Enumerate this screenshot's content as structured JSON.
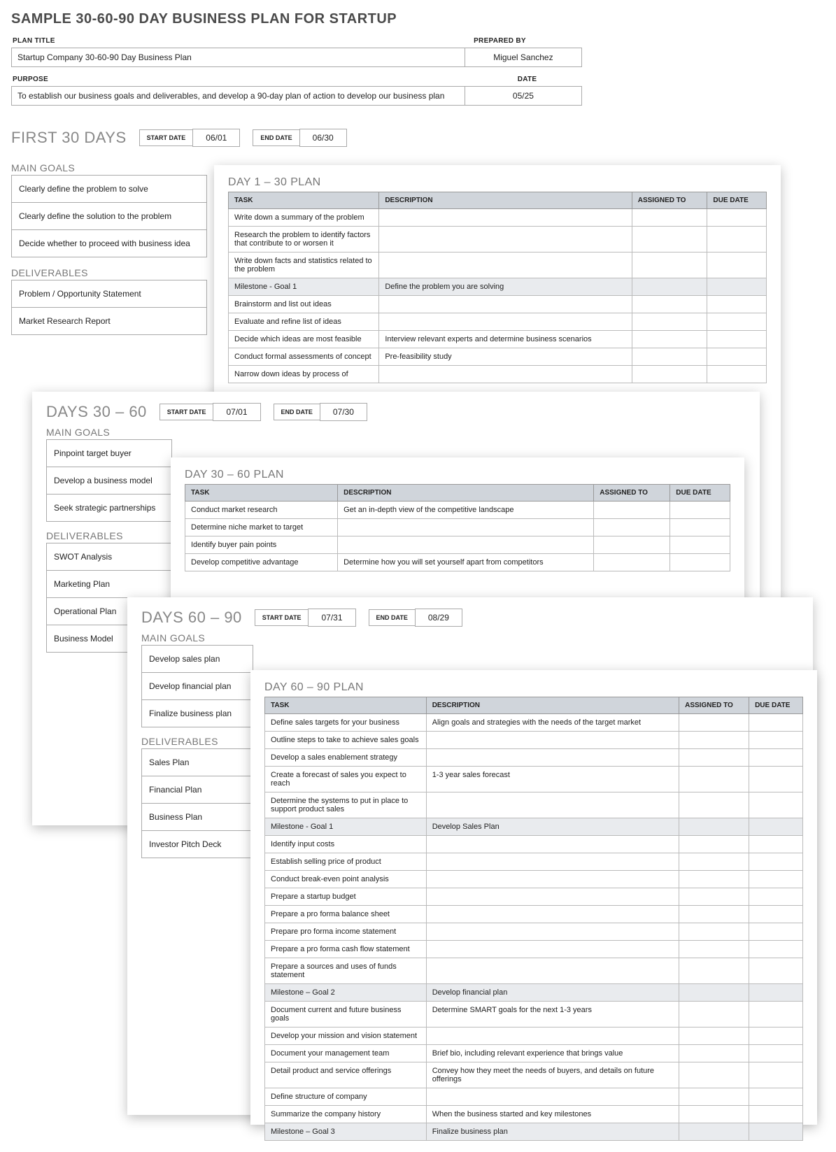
{
  "title": "SAMPLE 30-60-90 DAY BUSINESS PLAN FOR STARTUP",
  "meta": {
    "planTitleLabel": "PLAN TITLE",
    "planTitle": "Startup Company 30-60-90 Day Business Plan",
    "preparedByLabel": "PREPARED BY",
    "preparedBy": "Miguel Sanchez",
    "purposeLabel": "PURPOSE",
    "purpose": "To establish our business goals and deliverables, and develop a 90-day plan of action to develop our business plan",
    "dateLabel": "DATE",
    "date": "05/25"
  },
  "sections": {
    "first30": {
      "title": "FIRST 30 DAYS",
      "startLabel": "START DATE",
      "start": "06/01",
      "endLabel": "END DATE",
      "end": "06/30",
      "goalsLabel": "MAIN GOALS",
      "goals": [
        "Clearly define the problem to solve",
        "Clearly define the solution to the problem",
        "Decide whether to proceed with business idea"
      ],
      "delivLabel": "DELIVERABLES",
      "deliverables": [
        "Problem / Opportunity Statement",
        "Market Research Report"
      ],
      "planTitle": "DAY 1 – 30 PLAN",
      "cols": [
        "TASK",
        "DESCRIPTION",
        "ASSIGNED TO",
        "DUE DATE"
      ],
      "rows": [
        {
          "t": "Write down a summary of the problem",
          "d": ""
        },
        {
          "t": "Research the problem to identify factors that contribute to or worsen it",
          "d": ""
        },
        {
          "t": "Write down facts and statistics related to the problem",
          "d": ""
        },
        {
          "t": "Milestone - Goal 1",
          "d": "Define the problem you are solving",
          "m": true
        },
        {
          "t": "Brainstorm and list out ideas",
          "d": ""
        },
        {
          "t": "Evaluate and refine list of ideas",
          "d": ""
        },
        {
          "t": "Decide which ideas are most feasible",
          "d": "Interview relevant experts and determine business scenarios"
        },
        {
          "t": "Conduct formal assessments of concept",
          "d": "Pre-feasibility study"
        },
        {
          "t": "Narrow down ideas by process of",
          "d": ""
        }
      ]
    },
    "d3060": {
      "title": "DAYS 30 – 60",
      "startLabel": "START DATE",
      "start": "07/01",
      "endLabel": "END DATE",
      "end": "07/30",
      "goalsLabel": "MAIN GOALS",
      "goals": [
        "Pinpoint target buyer",
        "Develop a business model",
        "Seek strategic partnerships"
      ],
      "delivLabel": "DELIVERABLES",
      "deliverables": [
        "SWOT Analysis",
        "Marketing Plan",
        "Operational Plan",
        "Business Model"
      ],
      "planTitle": "DAY 30 – 60 PLAN",
      "cols": [
        "TASK",
        "DESCRIPTION",
        "ASSIGNED TO",
        "DUE DATE"
      ],
      "rows": [
        {
          "t": "Conduct market research",
          "d": "Get an in-depth view of the competitive landscape"
        },
        {
          "t": "Determine niche market to target",
          "d": ""
        },
        {
          "t": "Identify buyer pain points",
          "d": ""
        },
        {
          "t": "Develop competitive advantage",
          "d": "Determine how you will set yourself apart from competitors"
        }
      ]
    },
    "d6090": {
      "title": "DAYS 60 – 90",
      "startLabel": "START DATE",
      "start": "07/31",
      "endLabel": "END DATE",
      "end": "08/29",
      "goalsLabel": "MAIN GOALS",
      "goals": [
        "Develop sales plan",
        "Develop financial plan",
        "Finalize business plan"
      ],
      "delivLabel": "DELIVERABLES",
      "deliverables": [
        "Sales Plan",
        "Financial Plan",
        "Business Plan",
        "Investor Pitch Deck"
      ],
      "planTitle": "DAY 60 – 90 PLAN",
      "cols": [
        "TASK",
        "DESCRIPTION",
        "ASSIGNED TO",
        "DUE DATE"
      ],
      "rows": [
        {
          "t": "Define sales targets for your business",
          "d": "Align goals and strategies with the needs of the target market"
        },
        {
          "t": "Outline steps to take to achieve sales goals",
          "d": ""
        },
        {
          "t": "Develop a sales enablement strategy",
          "d": ""
        },
        {
          "t": "Create a forecast of sales you expect to reach",
          "d": "1-3 year sales forecast"
        },
        {
          "t": "Determine the systems to put in place to support product sales",
          "d": ""
        },
        {
          "t": "Milestone - Goal 1",
          "d": "Develop Sales Plan",
          "m": true
        },
        {
          "t": "Identify input costs",
          "d": ""
        },
        {
          "t": "Establish selling price of product",
          "d": ""
        },
        {
          "t": "Conduct break-even point analysis",
          "d": ""
        },
        {
          "t": "Prepare a startup budget",
          "d": ""
        },
        {
          "t": "Prepare a pro forma balance sheet",
          "d": ""
        },
        {
          "t": "Prepare pro forma income statement",
          "d": ""
        },
        {
          "t": "Prepare a pro forma cash flow statement",
          "d": ""
        },
        {
          "t": "Prepare a sources and uses of funds statement",
          "d": ""
        },
        {
          "t": "Milestone – Goal 2",
          "d": "Develop financial plan",
          "m": true
        },
        {
          "t": "Document current and future business goals",
          "d": "Determine SMART goals for the next 1-3 years"
        },
        {
          "t": "Develop your mission and vision statement",
          "d": ""
        },
        {
          "t": "Document your management team",
          "d": "Brief bio, including relevant experience that brings value"
        },
        {
          "t": "Detail product and service offerings",
          "d": "Convey how they meet the needs of buyers, and details on future offerings"
        },
        {
          "t": "Define structure of company",
          "d": ""
        },
        {
          "t": "Summarize the company history",
          "d": "When the business started and key milestones"
        },
        {
          "t": "Milestone – Goal 3",
          "d": "Finalize business plan",
          "m": true
        }
      ]
    }
  }
}
